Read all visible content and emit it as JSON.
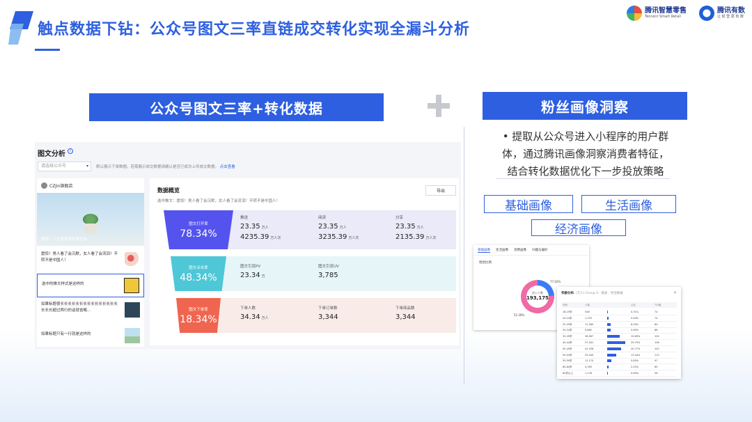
{
  "slide": {
    "title": "触点数据下钻：公众号图文三率直链成交转化实现全漏斗分析"
  },
  "logos": {
    "smart_retail": {
      "name": "腾讯智慧零售",
      "sub": "Tencent Smart Retail"
    },
    "youshu": {
      "name": "腾讯有数",
      "sub": "让 经 营 更 有 数"
    }
  },
  "left_banner": "公众号图文三率+转化数据",
  "right_banner": "粉丝画像洞察",
  "insight_lines": [
    "• 提取从公众号进入小程序的用户群",
    "体，通过腾讯画像洞察消费者特征，",
    "结合转化数据优化下一步投放策略"
  ],
  "tags": [
    "基础画像",
    "生活画像",
    "经济画像"
  ],
  "dashboard": {
    "title": "图文分析",
    "info_icon": "i",
    "select_placeholder": "请选择公众号",
    "note": "默认展示下单数据。若需展示成交数据请确认是否已成功上传成交数据。",
    "note_link": "点击查看",
    "account": {
      "name": "CZJin旗舰店",
      "hero_caption": "震惊！三文鱼竟然有寄生虫",
      "items": [
        "震惊！男人看了会沉默，女人看了会流泪！不转不是中国人！",
        "选中的推文样式是这样的",
        "如果标题很长长长长长长长长长长长长长长长长长长超过两行的话就省略...",
        "如果标题只有一行就是这样的"
      ]
    },
    "overview": {
      "title": "数据概览",
      "subtitle": "选中推文：震惊！男人看了会沉默，女人看了会流泪！不转不是中国人！",
      "export_label": "导出",
      "rows": [
        {
          "funnel_label": "图文打开率",
          "funnel_value": "78.34%",
          "cells": [
            {
              "label": "推送",
              "v1": "23.35",
              "u1": "万人",
              "v2": "4235.39",
              "u2": "万人次"
            },
            {
              "label": "阅读",
              "v1": "23.35",
              "u1": "万人",
              "v2": "3235.39",
              "u2": "万人次"
            },
            {
              "label": "分享",
              "v1": "23.35",
              "u1": "万人",
              "v2": "2135.39",
              "u2": "万人次"
            }
          ]
        },
        {
          "funnel_label": "图文点击率",
          "funnel_value": "48.34%",
          "cells": [
            {
              "label": "图文引流PV",
              "v1": "23.34",
              "u1": "万"
            },
            {
              "label": "图文引流UV",
              "v1": "3,785",
              "u1": ""
            }
          ]
        },
        {
          "funnel_label": "图文下单率",
          "funnel_value": "18.34%",
          "cells": [
            {
              "label": "下单人数",
              "v1": "34.34",
              "u1": "万人"
            },
            {
              "label": "下单订单数",
              "v1": "3,344",
              "u1": ""
            },
            {
              "label": "下单商品数",
              "v1": "3,344",
              "u1": ""
            }
          ]
        }
      ]
    }
  },
  "mini_shot_1": {
    "tabs": [
      "基础画像",
      "生活画像",
      "消费画像",
      "兴趣与偏好"
    ],
    "subtitle": "性别比例",
    "donut_label": "进入人数",
    "donut_value": "193,175",
    "pct_top": "77.02%",
    "pct_bottom": "52.39%",
    "male_share": 0.24
  },
  "mini_shot_2": {
    "title": "年龄分布",
    "title_muted": "(万人) Group A · 图表 · 导出数据",
    "close": "×",
    "headers": [
      "年龄",
      "人数",
      "",
      "占比",
      "TGI值"
    ],
    "rows": [
      {
        "c1": "18-19岁",
        "c2": "548",
        "bar": 0.04,
        "c4": "0.31%",
        "c5": "74"
      },
      {
        "c1": "20-24岁",
        "c2": "1,333",
        "bar": 0.08,
        "c4": "0.63%",
        "c5": "74"
      },
      {
        "c1": "25-29岁",
        "c2": "11,585",
        "bar": 0.18,
        "c4": "6.05%",
        "c5": "84"
      },
      {
        "c1": "30-34岁",
        "c2": "9,882",
        "bar": 0.16,
        "c4": "5.60%",
        "c5": "86"
      },
      {
        "c1": "35-39岁",
        "c2": "38,967",
        "bar": 0.6,
        "c4": "19.69%",
        "c5": "104"
      },
      {
        "c1": "40-44岁",
        "c2": "57,941",
        "bar": 0.85,
        "c4": "29.70%",
        "c5": "106"
      },
      {
        "c1": "45-49岁",
        "c2": "41,328",
        "bar": 0.66,
        "c4": "20.77%",
        "c5": "102"
      },
      {
        "c1": "50-54岁",
        "c2": "25,540",
        "bar": 0.42,
        "c4": "13.44%",
        "c5": "113"
      },
      {
        "c1": "55-59岁",
        "c2": "11,170",
        "bar": 0.2,
        "c4": "5.85%",
        "c5": "97"
      },
      {
        "c1": "60-64岁",
        "c2": "4,395",
        "bar": 0.08,
        "c4": "2.25%",
        "c5": "65"
      },
      {
        "c1": "65岁以上",
        "c2": "1,176",
        "bar": 0.03,
        "c4": "0.65%",
        "c5": "56"
      }
    ]
  },
  "colors": {
    "brand_blue": "#2d5fe0",
    "funnel_open": "#5553ee",
    "funnel_click": "#4ec7d7",
    "funnel_order": "#f0654f"
  }
}
